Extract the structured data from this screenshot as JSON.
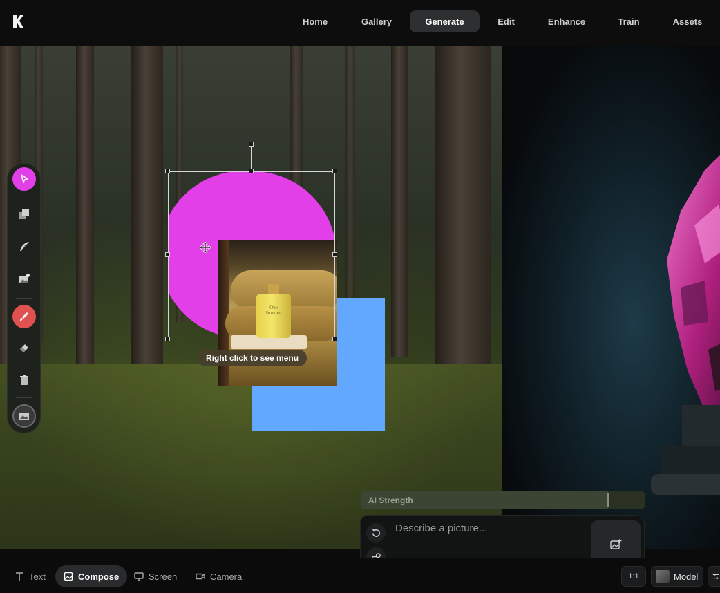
{
  "app": {
    "logo_icon": "krea-logo-icon"
  },
  "nav": {
    "items": [
      {
        "label": "Home",
        "active": false
      },
      {
        "label": "Gallery",
        "active": false
      },
      {
        "label": "Generate",
        "active": true
      },
      {
        "label": "Edit",
        "active": false
      },
      {
        "label": "Enhance",
        "active": false
      },
      {
        "label": "Train",
        "active": false
      },
      {
        "label": "Assets",
        "active": false
      }
    ]
  },
  "canvas": {
    "tooltip": "Right click to see menu",
    "photo_label_line1": "One",
    "photo_label_line2": "Summer",
    "colors": {
      "pink_shape": "#e33fe8",
      "blue_rect": "#62a8ff"
    }
  },
  "toolbar": {
    "tools": [
      {
        "name": "select-tool",
        "icon": "cursor-icon"
      },
      {
        "name": "layers-tool",
        "icon": "layers-icon"
      },
      {
        "name": "pen-tool",
        "icon": "quill-icon"
      },
      {
        "name": "add-image-tool",
        "icon": "image-plus-icon"
      },
      {
        "name": "brush-tool",
        "icon": "brush-icon"
      },
      {
        "name": "eraser-tool",
        "icon": "eraser-icon"
      },
      {
        "name": "delete-tool",
        "icon": "trash-icon"
      },
      {
        "name": "background-tool",
        "icon": "image-thumbnail-icon"
      }
    ]
  },
  "ai_strength": {
    "label": "AI Strength",
    "value": 0.87
  },
  "prompt": {
    "placeholder": "Describe a picture..."
  },
  "modes": [
    {
      "label": "Text",
      "icon": "text-icon",
      "active": false
    },
    {
      "label": "Compose",
      "icon": "image-icon",
      "active": true
    },
    {
      "label": "Screen",
      "icon": "monitor-icon",
      "active": false
    },
    {
      "label": "Camera",
      "icon": "camera-icon",
      "active": false
    }
  ],
  "settings": {
    "aspect_ratio": "1:1",
    "model_label": "Model"
  }
}
